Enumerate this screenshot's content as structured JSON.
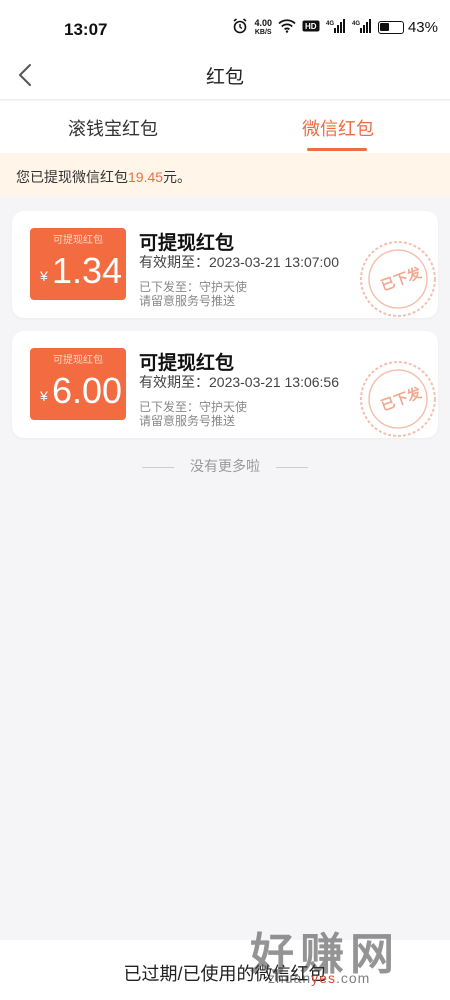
{
  "status_bar": {
    "time": "13:07",
    "network_speed": "4.00",
    "network_speed_unit": "KB/S",
    "battery_percent": "43%",
    "icons": [
      "alarm-icon",
      "wifi-icon",
      "hd-icon",
      "signal-4g-icon",
      "signal-4g-icon",
      "battery-icon"
    ]
  },
  "nav": {
    "title": "红包",
    "back_icon": "chevron-left-icon"
  },
  "tabs": [
    {
      "label": "滚钱宝红包",
      "active": false
    },
    {
      "label": "微信红包",
      "active": true
    }
  ],
  "notice": {
    "prefix": "您已提现微信红包",
    "amount": "19.45",
    "suffix": "元。"
  },
  "cards": [
    {
      "tag": "可提现红包",
      "currency": "¥",
      "amount": "1.34",
      "title": "可提现红包",
      "expiry": "有效期至：2023-03-21 13:07:00",
      "note1": "已下发至：守护天使",
      "note2": "请留意服务号推送",
      "stamp": "已下发"
    },
    {
      "tag": "可提现红包",
      "currency": "¥",
      "amount": "6.00",
      "title": "可提现红包",
      "expiry": "有效期至：2023-03-21 13:06:56",
      "note1": "已下发至：守护天使",
      "note2": "请留意服务号推送",
      "stamp": "已下发"
    }
  ],
  "no_more": "没有更多啦",
  "bottom_link": "已过期/已使用的微信红包",
  "watermark": {
    "big": "好赚网",
    "small_1": "zhuan",
    "small_2": "yes",
    "small_3": ".com"
  },
  "colors": {
    "accent": "#f06c42",
    "coupon": "#f26b41",
    "notice_bg": "#fff6e9",
    "page_bg": "#f5f5f7",
    "stamp": "#f0a88f"
  }
}
